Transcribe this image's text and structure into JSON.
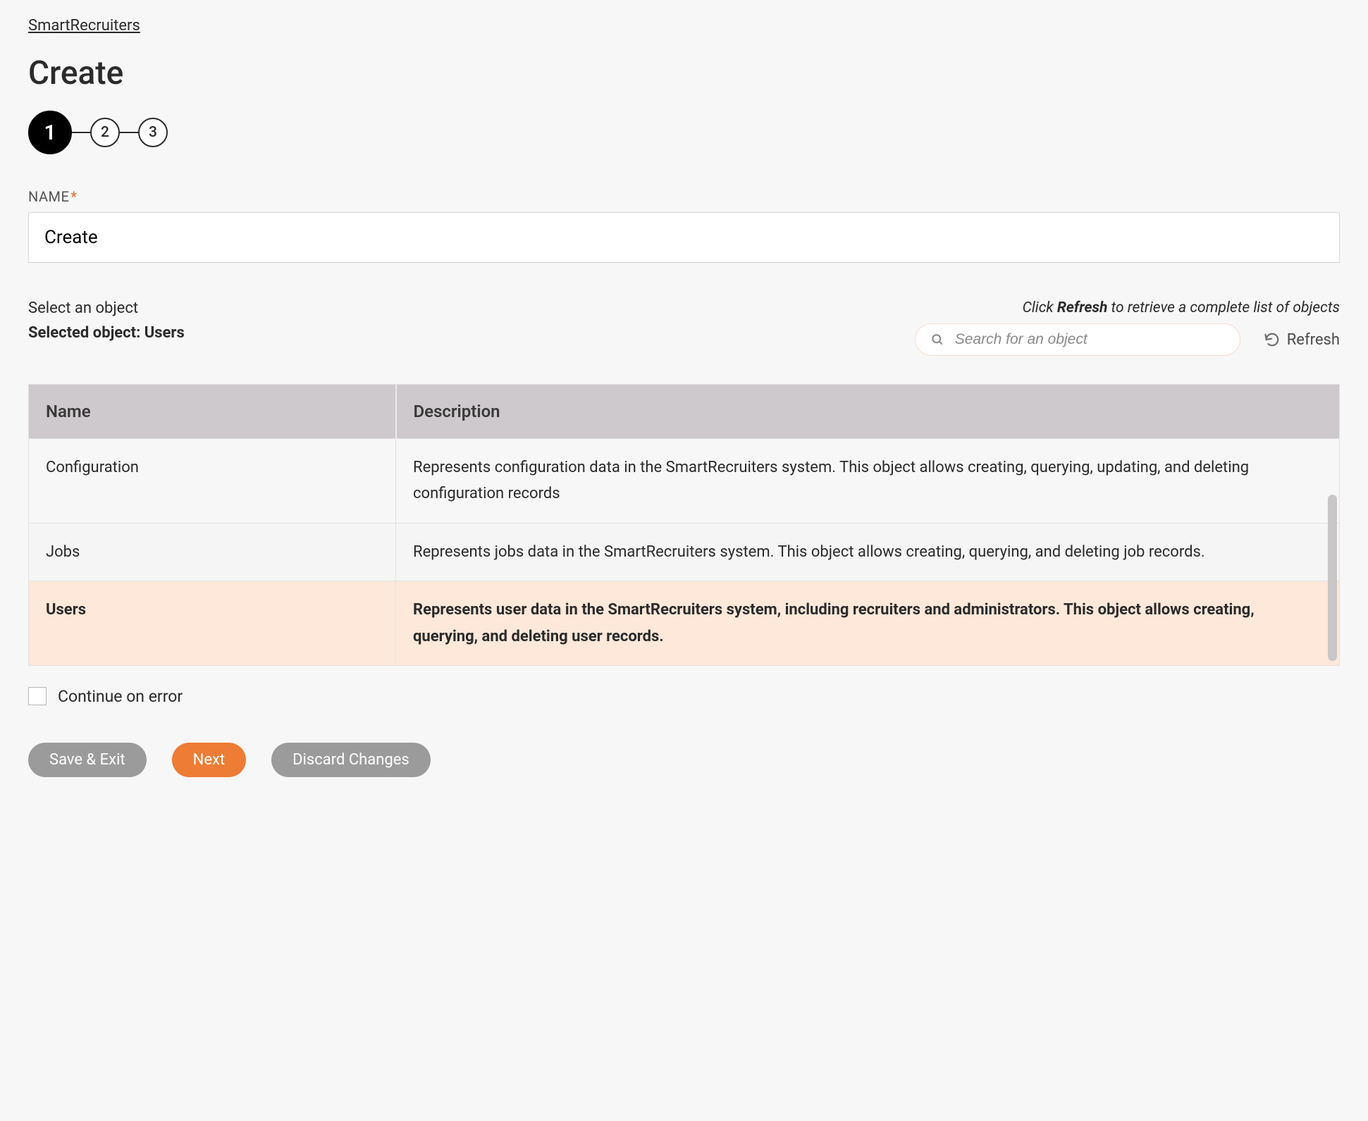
{
  "breadcrumb": {
    "label": "SmartRecruiters"
  },
  "page": {
    "title": "Create"
  },
  "stepper": {
    "steps": [
      "1",
      "2",
      "3"
    ],
    "active_index": 0
  },
  "name_field": {
    "label": "NAME",
    "required_mark": "*",
    "value": "Create"
  },
  "object_select": {
    "instruction": "Select an object",
    "selected_prefix": "Selected object: ",
    "selected_value": "Users",
    "hint_prefix": "Click ",
    "hint_bold": "Refresh",
    "hint_suffix": " to retrieve a complete list of objects",
    "search_placeholder": "Search for an object",
    "refresh_label": "Refresh"
  },
  "table": {
    "headers": {
      "name": "Name",
      "description": "Description"
    },
    "rows": [
      {
        "name": "Configuration",
        "description": "Represents configuration data in the SmartRecruiters system. This object allows creating, querying, updating, and deleting configuration records",
        "selected": false
      },
      {
        "name": "Jobs",
        "description": "Represents jobs data in the SmartRecruiters system. This object allows creating, querying, and deleting job records.",
        "selected": false
      },
      {
        "name": "Users",
        "description": "Represents user data in the SmartRecruiters system, including recruiters and administrators. This object allows creating, querying, and deleting user records.",
        "selected": true
      }
    ]
  },
  "continue_on_error": {
    "label": "Continue on error",
    "checked": false
  },
  "buttons": {
    "save_exit": "Save & Exit",
    "next": "Next",
    "discard": "Discard Changes"
  }
}
